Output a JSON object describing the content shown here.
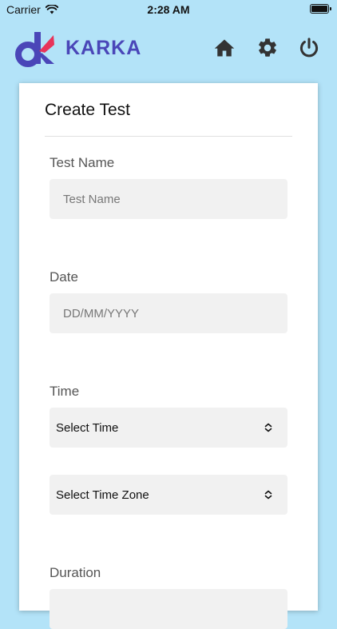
{
  "status_bar": {
    "carrier": "Carrier",
    "time": "2:28 AM"
  },
  "header": {
    "brand": "KARKA",
    "icons": [
      "home-icon",
      "settings-icon",
      "power-icon"
    ],
    "brand_colors": {
      "navy": "#4a46b8",
      "pink": "#e8345a"
    }
  },
  "form": {
    "title": "Create Test",
    "test_name": {
      "label": "Test Name",
      "placeholder": "Test Name"
    },
    "date": {
      "label": "Date",
      "placeholder": "DD/MM/YYYY"
    },
    "time": {
      "label": "Time",
      "select_time": "Select Time",
      "select_zone": "Select Time Zone"
    },
    "duration": {
      "label": "Duration"
    }
  },
  "colors": {
    "background": "#b3e3f8",
    "card": "#ffffff",
    "field": "#f1f1f1"
  }
}
